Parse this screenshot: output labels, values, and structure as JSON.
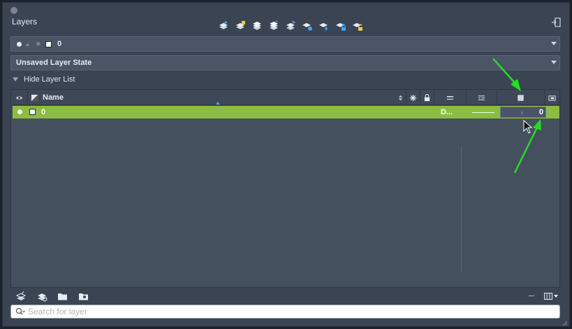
{
  "panel": {
    "title": "Layers"
  },
  "toolbar": {
    "icons": [
      "new-layer-icon",
      "new-vp-freeze-layer-icon",
      "delete-layer-icon",
      "set-current-icon",
      "merge-layers-icon",
      "layer-settings-icon",
      "layer-walk-icon",
      "lock-layer-icon",
      "unlock-layer-icon"
    ]
  },
  "current_layer": {
    "name": "0"
  },
  "layer_state": {
    "label": "Unsaved Layer State"
  },
  "layer_list": {
    "toggle_label": "Hide Layer List"
  },
  "columns": {
    "name": "Name",
    "icons": [
      "eye-icon",
      "color-icon",
      "freeze-icon",
      "lock-icon",
      "lineweight-icon",
      "linetype-icon",
      "transparency-icon",
      "viewport-icon"
    ]
  },
  "rows": [
    {
      "name": "0",
      "linetype": "D...",
      "value": "0",
      "selected": true
    }
  ],
  "search": {
    "placeholder": "Search for layer",
    "value": ""
  },
  "colors": {
    "accent_row": "#8bbd45",
    "annotation_arrow": "#22dd22",
    "panel_bg": "#3b4453"
  }
}
